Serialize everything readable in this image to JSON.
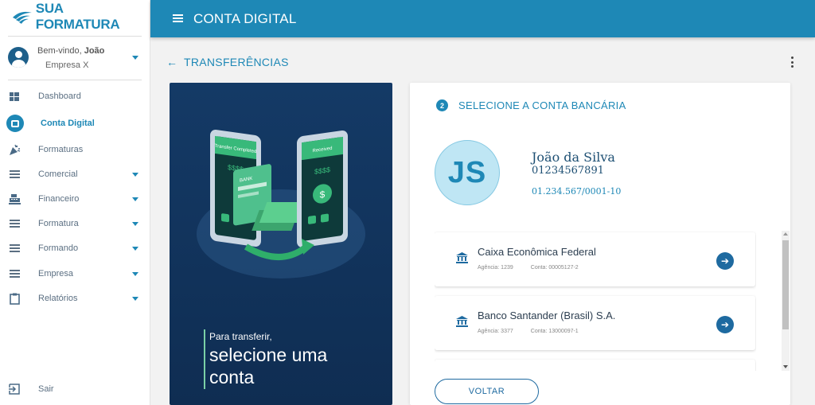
{
  "brand": {
    "logo_text": "SUA FORMATURA",
    "primary_color": "#1e88b6",
    "dark_color": "#143a66"
  },
  "user": {
    "greeting": "Bem-vindo,",
    "name": "João",
    "company": "Empresa X"
  },
  "sidebar": {
    "items": [
      {
        "label": "Dashboard",
        "icon": "dashboard-icon"
      },
      {
        "label": "Conta Digital",
        "icon": "wallet-icon",
        "active": true
      },
      {
        "label": "Formaturas",
        "icon": "party-icon"
      },
      {
        "label": "Comercial",
        "icon": "menu-icon",
        "expandable": true
      },
      {
        "label": "Financeiro",
        "icon": "cash-register-icon",
        "expandable": true
      },
      {
        "label": "Formatura",
        "icon": "menu-icon",
        "expandable": true
      },
      {
        "label": "Formando",
        "icon": "menu-icon",
        "expandable": true
      },
      {
        "label": "Empresa",
        "icon": "menu-icon",
        "expandable": true
      },
      {
        "label": "Relatórios",
        "icon": "clipboard-icon",
        "expandable": true
      }
    ],
    "logout": {
      "label": "Sair",
      "icon": "logout-icon"
    }
  },
  "topbar": {
    "title": "CONTA DIGITAL"
  },
  "page": {
    "title": "TRANSFERÊNCIAS"
  },
  "promo": {
    "small_text": "Para transferir,",
    "big_text": "selecione uma conta",
    "illustration": {
      "left_phone": "Transfer Completed",
      "right_phone": "Received",
      "amount": "$$$$",
      "card": "BANK"
    }
  },
  "step": {
    "number": "2",
    "title": "SELECIONE A CONTA BANCÁRIA"
  },
  "account_holder": {
    "initials": "JS",
    "name": "João da Silva",
    "id": "01234567891",
    "document": "01.234.567/0001-10"
  },
  "bank_accounts": [
    {
      "bank": "Caixa Econômica Federal",
      "agency": "Agência: 1239",
      "account": "Conta: 00005127-2"
    },
    {
      "bank": "Banco Santander (Brasil) S.A.",
      "agency": "Agência: 3377",
      "account": "Conta: 13000097-1"
    }
  ],
  "buttons": {
    "back": "VOLTAR"
  }
}
